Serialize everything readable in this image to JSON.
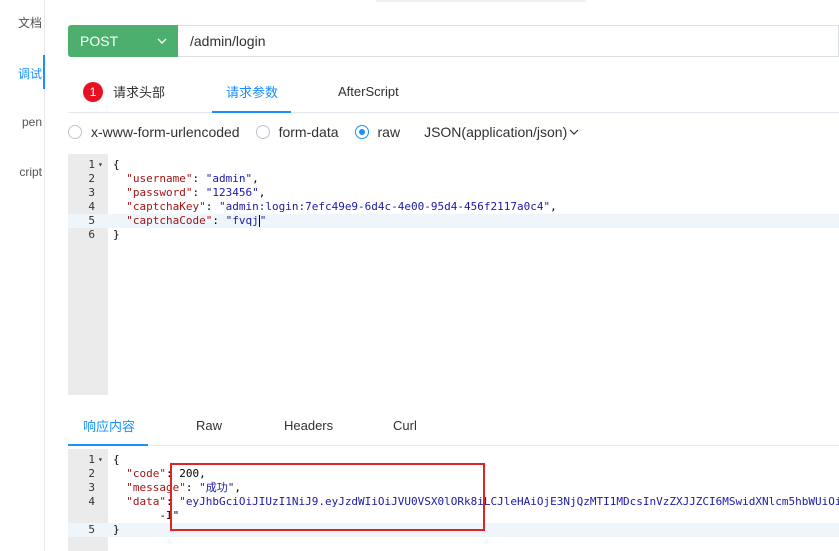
{
  "sidebar": {
    "items": [
      {
        "label": "文档",
        "active": false
      },
      {
        "label": "调试",
        "active": true
      },
      {
        "label": "pen",
        "active": false
      },
      {
        "label": "cript",
        "active": false
      }
    ]
  },
  "request": {
    "method": "POST",
    "url": "/admin/login"
  },
  "request_tabs": {
    "headers_label": "请求头部",
    "headers_count": "1",
    "params_label": "请求参数",
    "afterscript_label": "AfterScript"
  },
  "body_type": {
    "options": [
      "x-www-form-urlencoded",
      "form-data",
      "raw"
    ],
    "selected": "raw",
    "content_type": "JSON(application/json)"
  },
  "request_body": {
    "lines": [
      [
        "{"
      ],
      [
        "  ",
        "\"username\"",
        ": ",
        "\"admin\"",
        ","
      ],
      [
        "  ",
        "\"password\"",
        ": ",
        "\"123456\"",
        ","
      ],
      [
        "  ",
        "\"captchaKey\"",
        ": ",
        "\"admin:login:7efc49e9-6d4c-4e00-95d4-456f2117a0c4\"",
        ","
      ],
      [
        "  ",
        "\"captchaCode\"",
        ": ",
        "\"fvqj\"",
        ""
      ],
      [
        "}"
      ]
    ]
  },
  "response_tabs": {
    "content_label": "响应内容",
    "raw_label": "Raw",
    "headers_label": "Headers",
    "curl_label": "Curl"
  },
  "response_body": {
    "lines": [
      [
        "{"
      ],
      [
        "  ",
        "\"code\"",
        ": ",
        "200",
        ","
      ],
      [
        "  ",
        "\"message\"",
        ": ",
        "\"成功\"",
        ","
      ],
      [
        "  ",
        "\"data\"",
        ": ",
        "\"eyJhbGciOiJIUzI1NiJ9.eyJzdWIiOiJVU0VSX0lORk8iLCJleHAiOjE3NjQzMTI1MDcsInVzZXJJZCI6MSwidXNlcm5hbWUiOi",
        ""
      ],
      [
        "       -I\""
      ],
      [
        "}"
      ]
    ]
  },
  "colors": {
    "accent": "#1890ff",
    "method": "#4caf6e",
    "badge": "#e81123",
    "highlight_box": "#e02424"
  }
}
